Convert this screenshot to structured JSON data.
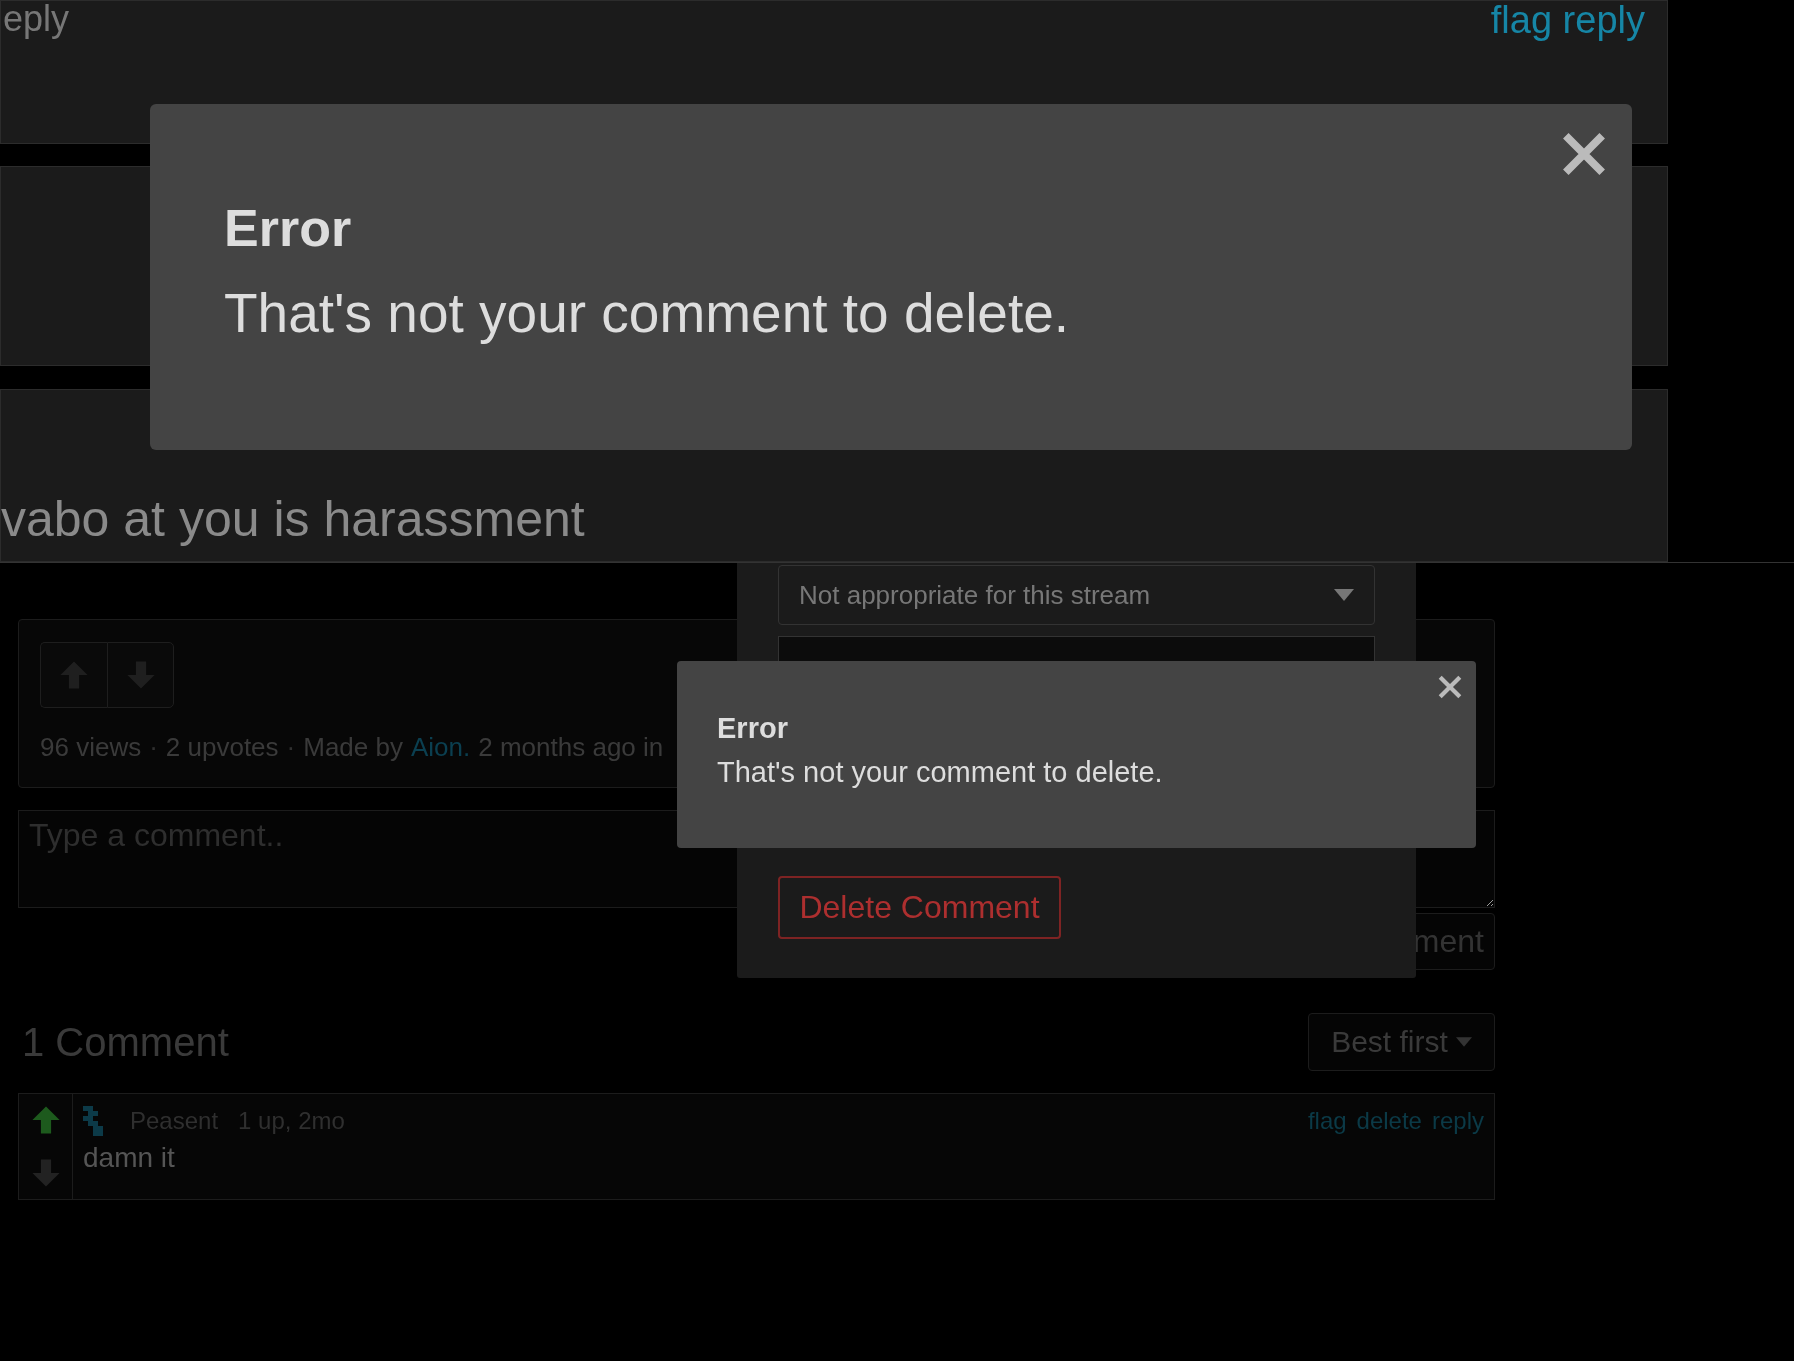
{
  "top_screenshot": {
    "comments": [
      {
        "left_text": "eply",
        "actions": "flag reply"
      },
      {
        "body": "vabo at you is harassment"
      }
    ],
    "error_dialog": {
      "title": "Error",
      "message": "That's not your comment to delete."
    }
  },
  "bottom_screenshot": {
    "post_stats": {
      "views": "96 views",
      "separator": "·",
      "upvotes": "2 upvotes",
      "made_by": "Made by",
      "author": "Aion.",
      "time": "2 months ago in"
    },
    "comment_field": {
      "placeholder": "Type a comment.."
    },
    "post_button": "ment",
    "comment_count": "1 Comment",
    "sort": "Best first",
    "comments": [
      {
        "user": "Peasent",
        "meta": "1 up, 2mo",
        "upvoted": true,
        "actions": [
          "flag",
          "delete",
          "reply"
        ],
        "text": "damn it"
      }
    ],
    "report_dialog": {
      "reason": "Not appropriate for this stream",
      "delete_button": "Delete Comment"
    },
    "error_dialog": {
      "title": "Error",
      "message": "That's not your comment to delete."
    }
  }
}
